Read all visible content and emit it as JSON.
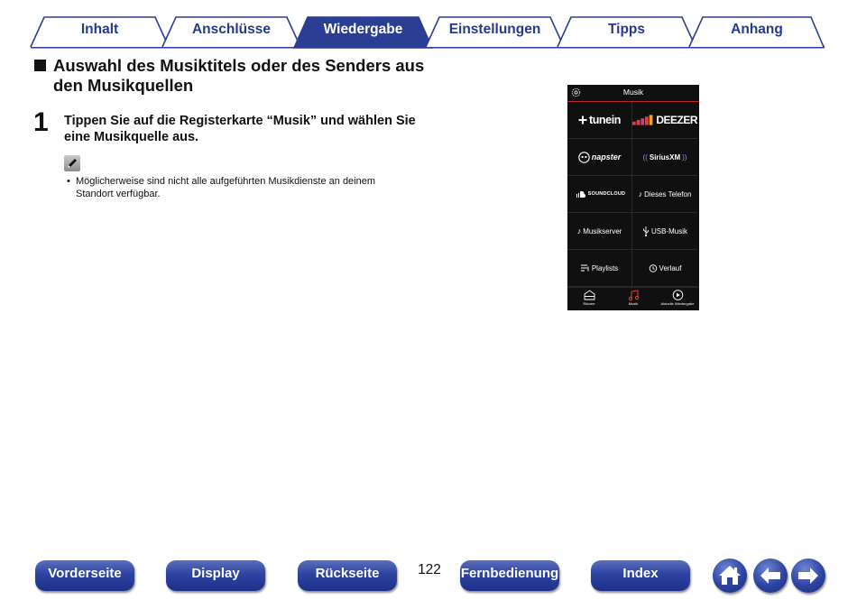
{
  "tabs": [
    {
      "label": "Inhalt",
      "active": false
    },
    {
      "label": "Anschlüsse",
      "active": false
    },
    {
      "label": "Wiedergabe",
      "active": true
    },
    {
      "label": "Einstellungen",
      "active": false
    },
    {
      "label": "Tipps",
      "active": false
    },
    {
      "label": "Anhang",
      "active": false
    }
  ],
  "section": {
    "title": "Auswahl des Musiktitels oder des Senders aus den Musikquellen"
  },
  "step": {
    "number": "1",
    "text": "Tippen Sie auf die Registerkarte “Musik” und wählen Sie eine Musikquelle aus."
  },
  "note": {
    "bullet": "•",
    "text": "Möglicherweise sind nicht alle aufgeführten Musikdienste an deinem Standort verfügbar."
  },
  "phone": {
    "title": "Musik",
    "grid": [
      {
        "label": "tunein",
        "icon": "tunein-logo"
      },
      {
        "label": "DEEZER",
        "icon": "deezer-logo"
      },
      {
        "label": "napster",
        "icon": "napster-logo"
      },
      {
        "label": "SiriusXM",
        "icon": "siriusxm-logo"
      },
      {
        "label": "SOUNDCLOUD",
        "icon": "soundcloud-logo"
      },
      {
        "label": "Dieses Telefon",
        "icon": "music-note-icon"
      },
      {
        "label": "Musikserver",
        "icon": "music-note-icon"
      },
      {
        "label": "USB-Musik",
        "icon": "usb-icon"
      },
      {
        "label": "Playlists",
        "icon": "playlist-icon"
      },
      {
        "label": "Verlauf",
        "icon": "history-icon"
      }
    ],
    "nav": [
      {
        "label": "Räume",
        "icon": "rooms-icon"
      },
      {
        "label": "Musik",
        "icon": "music-icon",
        "active": true
      },
      {
        "label": "Aktuelle Wiedergabe",
        "icon": "play-icon"
      }
    ],
    "accent": "#c0282e"
  },
  "footer": {
    "buttons": {
      "front": "Vorderseite",
      "display": "Display",
      "rear": "Rückseite",
      "remote": "Fernbedienung",
      "index": "Index"
    },
    "page_number": "122"
  },
  "colors": {
    "tab_active": "#2b3e94",
    "tab_text": "#243a8c",
    "nav_button": "#2d43a0"
  }
}
